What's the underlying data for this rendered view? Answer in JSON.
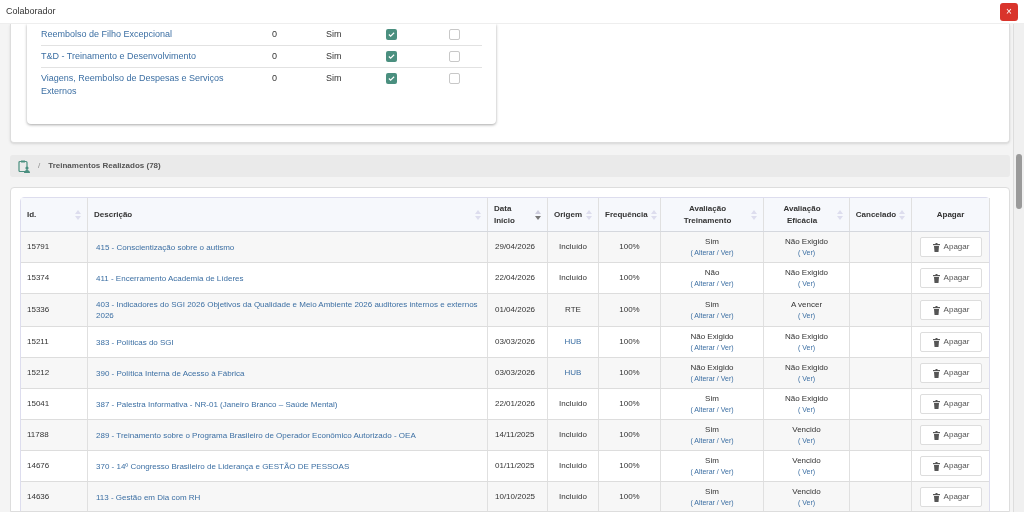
{
  "window": {
    "title": "Colaborador",
    "close": "×"
  },
  "benefits": [
    {
      "name": "Reembolso de Filho Excepcional",
      "count": "0",
      "answer": "Sim",
      "checked_a": true,
      "checked_b": false
    },
    {
      "name": "T&D - Treinamento e Desenvolvimento",
      "count": "0",
      "answer": "Sim",
      "checked_a": true,
      "checked_b": false
    },
    {
      "name": "Viagens, Reembolso de Despesas e Serviços Externos",
      "count": "0",
      "answer": "Sim",
      "checked_a": true,
      "checked_b": false
    }
  ],
  "breadcrumb": {
    "separator": "/",
    "title": "Treinamentos Realizados (78)"
  },
  "table": {
    "columns": [
      {
        "label": "Id.",
        "sortable": true,
        "sorted": false
      },
      {
        "label": "Descrição",
        "sortable": true,
        "sorted": false
      },
      {
        "label": "Data Início",
        "sortable": true,
        "sorted": true
      },
      {
        "label": "Origem",
        "sortable": true,
        "sorted": false
      },
      {
        "label": "Frequência",
        "sortable": true,
        "sorted": false
      },
      {
        "label": "Avaliação Treinamento",
        "sortable": true,
        "sorted": false
      },
      {
        "label": "Avaliação Eficácia",
        "sortable": true,
        "sorted": false
      },
      {
        "label": "Cancelado",
        "sortable": true,
        "sorted": false
      },
      {
        "label": "Apagar",
        "sortable": false,
        "sorted": false
      }
    ],
    "rows": [
      {
        "id": "15791",
        "description": "415 - Conscientização sobre o autismo",
        "date": "29/04/2026",
        "origin": "Incluído",
        "origin_link": false,
        "frequency": "100%",
        "training_eval": "Sim",
        "training_action": "( Alterar / Ver)",
        "efficacy_eval": "Não Exigido",
        "efficacy_action": "( Ver)",
        "delete": "Apagar"
      },
      {
        "id": "15374",
        "description": "411 - Encerramento Academia de Líderes",
        "date": "22/04/2026",
        "origin": "Incluído",
        "origin_link": false,
        "frequency": "100%",
        "training_eval": "Não",
        "training_action": "( Alterar / Ver)",
        "efficacy_eval": "Não Exigido",
        "efficacy_action": "( Ver)",
        "delete": "Apagar"
      },
      {
        "id": "15336",
        "description": "403 - Indicadores do SGI 2026 Objetivos da Qualidade e Meio Ambiente 2026 auditores internos e externos 2026",
        "date": "01/04/2026",
        "origin": "RTE",
        "origin_link": false,
        "frequency": "100%",
        "training_eval": "Sim",
        "training_action": "( Alterar / Ver)",
        "efficacy_eval": "A vencer",
        "efficacy_action": "( Ver)",
        "delete": "Apagar"
      },
      {
        "id": "15211",
        "description": "383 - Políticas do SGI",
        "date": "03/03/2026",
        "origin": "HUB",
        "origin_link": true,
        "frequency": "100%",
        "training_eval": "Não Exigido",
        "training_action": "( Alterar / Ver)",
        "efficacy_eval": "Não Exigido",
        "efficacy_action": "( Ver)",
        "delete": "Apagar"
      },
      {
        "id": "15212",
        "description": "390 - Política Interna de Acesso à Fábrica",
        "date": "03/03/2026",
        "origin": "HUB",
        "origin_link": true,
        "frequency": "100%",
        "training_eval": "Não Exigido",
        "training_action": "( Alterar / Ver)",
        "efficacy_eval": "Não Exigido",
        "efficacy_action": "( Ver)",
        "delete": "Apagar"
      },
      {
        "id": "15041",
        "description": "387 - Palestra Informativa - NR-01 (Janeiro Branco – Saúde Mental)",
        "date": "22/01/2026",
        "origin": "Incluído",
        "origin_link": false,
        "frequency": "100%",
        "training_eval": "Sim",
        "training_action": "( Alterar / Ver)",
        "efficacy_eval": "Não Exigido",
        "efficacy_action": "( Ver)",
        "delete": "Apagar"
      },
      {
        "id": "11788",
        "description": "289 - Treinamento sobre o Programa Brasileiro de Operador Econômico Autorizado - OEA",
        "date": "14/11/2025",
        "origin": "Incluído",
        "origin_link": false,
        "frequency": "100%",
        "training_eval": "Sim",
        "training_action": "( Alterar / Ver)",
        "efficacy_eval": "Vencido",
        "efficacy_action": "( Ver)",
        "delete": "Apagar"
      },
      {
        "id": "14676",
        "description": "370 - 14º Congresso Brasileiro de Liderança e GESTÃO DE PESSOAS",
        "date": "01/11/2025",
        "origin": "Incluído",
        "origin_link": false,
        "frequency": "100%",
        "training_eval": "Sim",
        "training_action": "( Alterar / Ver)",
        "efficacy_eval": "Vencido",
        "efficacy_action": "( Ver)",
        "delete": "Apagar"
      },
      {
        "id": "14636",
        "description": "113 - Gestão em Dia com RH",
        "date": "10/10/2025",
        "origin": "Incluído",
        "origin_link": false,
        "frequency": "100%",
        "training_eval": "Sim",
        "training_action": "( Alterar / Ver)",
        "efficacy_eval": "Vencido",
        "efficacy_action": "( Ver)",
        "delete": "Apagar"
      }
    ]
  }
}
